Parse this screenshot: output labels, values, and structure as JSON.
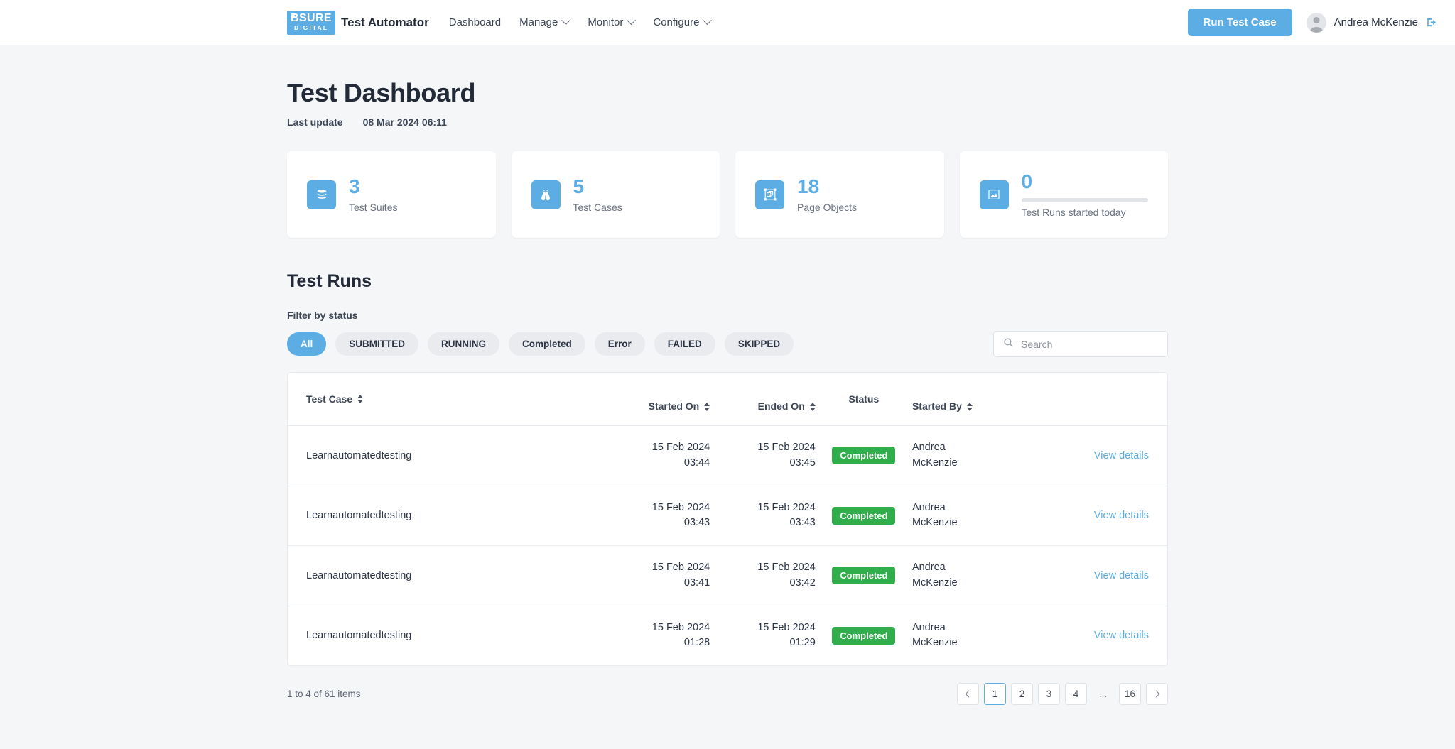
{
  "header": {
    "logo_top": "BSURE",
    "logo_bottom": "DIGITAL",
    "brand": "Test Automator",
    "nav": [
      {
        "label": "Dashboard",
        "has_chevron": false
      },
      {
        "label": "Manage",
        "has_chevron": true
      },
      {
        "label": "Monitor",
        "has_chevron": true
      },
      {
        "label": "Configure",
        "has_chevron": true
      }
    ],
    "run_button": "Run Test Case",
    "user_name": "Andrea McKenzie",
    "logout_icon": "logout-icon",
    "avatar_icon": "avatar-icon"
  },
  "page": {
    "title": "Test Dashboard",
    "last_update_label": "Last update",
    "last_update_value": "08 Mar 2024 06:11"
  },
  "stats": [
    {
      "value": "3",
      "label": "Test Suites",
      "icon": "database-icon",
      "has_progress": false
    },
    {
      "value": "5",
      "label": "Test Cases",
      "icon": "binoculars-icon",
      "has_progress": false
    },
    {
      "value": "18",
      "label": "Page Objects",
      "icon": "page-object-icon",
      "has_progress": false
    },
    {
      "value": "0",
      "label": "Test Runs started today",
      "icon": "chart-area-icon",
      "has_progress": true
    }
  ],
  "test_runs": {
    "section_title": "Test Runs",
    "filter_label": "Filter by status",
    "filters": [
      {
        "label": "All",
        "active": true
      },
      {
        "label": "SUBMITTED",
        "active": false
      },
      {
        "label": "RUNNING",
        "active": false
      },
      {
        "label": "Completed",
        "active": false
      },
      {
        "label": "Error",
        "active": false
      },
      {
        "label": "FAILED",
        "active": false
      },
      {
        "label": "SKIPPED",
        "active": false
      }
    ],
    "search": {
      "placeholder": "Search",
      "value": "",
      "icon": "search-icon"
    },
    "columns": [
      {
        "label": "Test Case",
        "sortable": true
      },
      {
        "label": "Started On",
        "sortable": true
      },
      {
        "label": "Ended On",
        "sortable": true
      },
      {
        "label": "Status",
        "sortable": false
      },
      {
        "label": "Started By",
        "sortable": true
      }
    ],
    "rows": [
      {
        "test_case": "Learnautomatedtesting",
        "started_on": "15 Feb 2024\n03:44",
        "ended_on": "15 Feb 2024\n03:45",
        "status": "Completed",
        "started_by": "Andrea\nMcKenzie",
        "action": "View details"
      },
      {
        "test_case": "Learnautomatedtesting",
        "started_on": "15 Feb 2024\n03:43",
        "ended_on": "15 Feb 2024\n03:43",
        "status": "Completed",
        "started_by": "Andrea\nMcKenzie",
        "action": "View details"
      },
      {
        "test_case": "Learnautomatedtesting",
        "started_on": "15 Feb 2024\n03:41",
        "ended_on": "15 Feb 2024\n03:42",
        "status": "Completed",
        "started_by": "Andrea\nMcKenzie",
        "action": "View details"
      },
      {
        "test_case": "Learnautomatedtesting",
        "started_on": "15 Feb 2024\n01:28",
        "ended_on": "15 Feb 2024\n01:29",
        "status": "Completed",
        "started_by": "Andrea\nMcKenzie",
        "action": "View details"
      }
    ],
    "pagination": {
      "info": "1 to 4 of 61 items",
      "prev_icon": "chevron-left-icon",
      "next_icon": "chevron-right-icon",
      "pages": [
        {
          "label": "1",
          "current": true,
          "ellipsis": false
        },
        {
          "label": "2",
          "current": false,
          "ellipsis": false
        },
        {
          "label": "3",
          "current": false,
          "ellipsis": false
        },
        {
          "label": "4",
          "current": false,
          "ellipsis": false
        },
        {
          "label": "...",
          "current": false,
          "ellipsis": true
        },
        {
          "label": "16",
          "current": false,
          "ellipsis": false
        }
      ]
    }
  },
  "colors": {
    "accent": "#5cade4",
    "success": "#2fae4b",
    "page_bg": "#f4f6f8",
    "text": "#2b3445"
  }
}
